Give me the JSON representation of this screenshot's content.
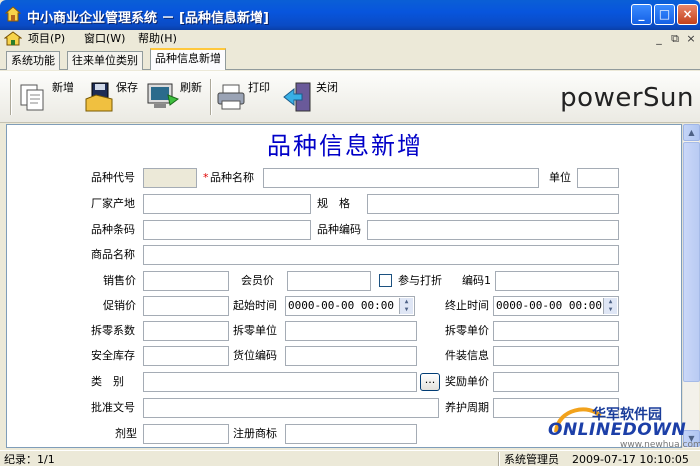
{
  "window": {
    "title": "中小商业企业管理系统 － [品种信息新增]",
    "buttons": {
      "minimize": "_",
      "maximize": "□",
      "close": "×"
    }
  },
  "menubar": {
    "items": [
      {
        "label": "项目(P)"
      },
      {
        "label": "窗口(W)"
      },
      {
        "label": "帮助(H)"
      }
    ],
    "mdi_buttons": {
      "minimize": "_",
      "restore": "⧉",
      "close": "×"
    }
  },
  "tabs": [
    {
      "label": "系统功能"
    },
    {
      "label": "往来单位类别"
    },
    {
      "label": "品种信息新增"
    }
  ],
  "toolbar": {
    "new_label": "新增",
    "save_label": "保存",
    "refresh_label": "刷新",
    "print_label": "打印",
    "close_label": "关闭",
    "brand": "powerSun"
  },
  "form": {
    "title": "品种信息新增",
    "labels": {
      "code": "品种代号",
      "name": "品种名称",
      "unit": "单位",
      "manufacturer": "厂家产地",
      "spec": "规　格",
      "barcode": "品种条码",
      "item_code": "品种编码",
      "product_name": "商品名称",
      "sale_price": "销售价",
      "member_price": "会员价",
      "join_discount": "参与打折",
      "code1": "编码1",
      "promo_price": "促销价",
      "start_time": "起始时间",
      "end_time": "终止时间",
      "split_factor": "拆零系数",
      "split_unit": "拆零单位",
      "split_price": "拆零单价",
      "safety_stock": "安全库存",
      "location_code": "货位编码",
      "package_info": "件装信息",
      "category": "类　别",
      "bonus_price": "奖励单价",
      "approval_no": "批准文号",
      "maintenance_period": "养护周期",
      "dosage_form": "剂型",
      "trademark": "注册商标"
    },
    "values": {
      "start_time": "0000-00-00 00:00",
      "end_time": "0000-00-00 00:00",
      "category_button": "..."
    },
    "required_mark": "*"
  },
  "watermark": {
    "cn": "华军软件园",
    "en": "ONLINEDOWN",
    "url": "www.newhua.com"
  },
  "statusbar": {
    "record": "纪录：1/1",
    "user": "系统管理员",
    "datetime": "2009-07-17 10:10:05"
  },
  "colors": {
    "title_blue": "#0000c8",
    "titlebar": "#0a5fd6",
    "required": "#e00000"
  }
}
